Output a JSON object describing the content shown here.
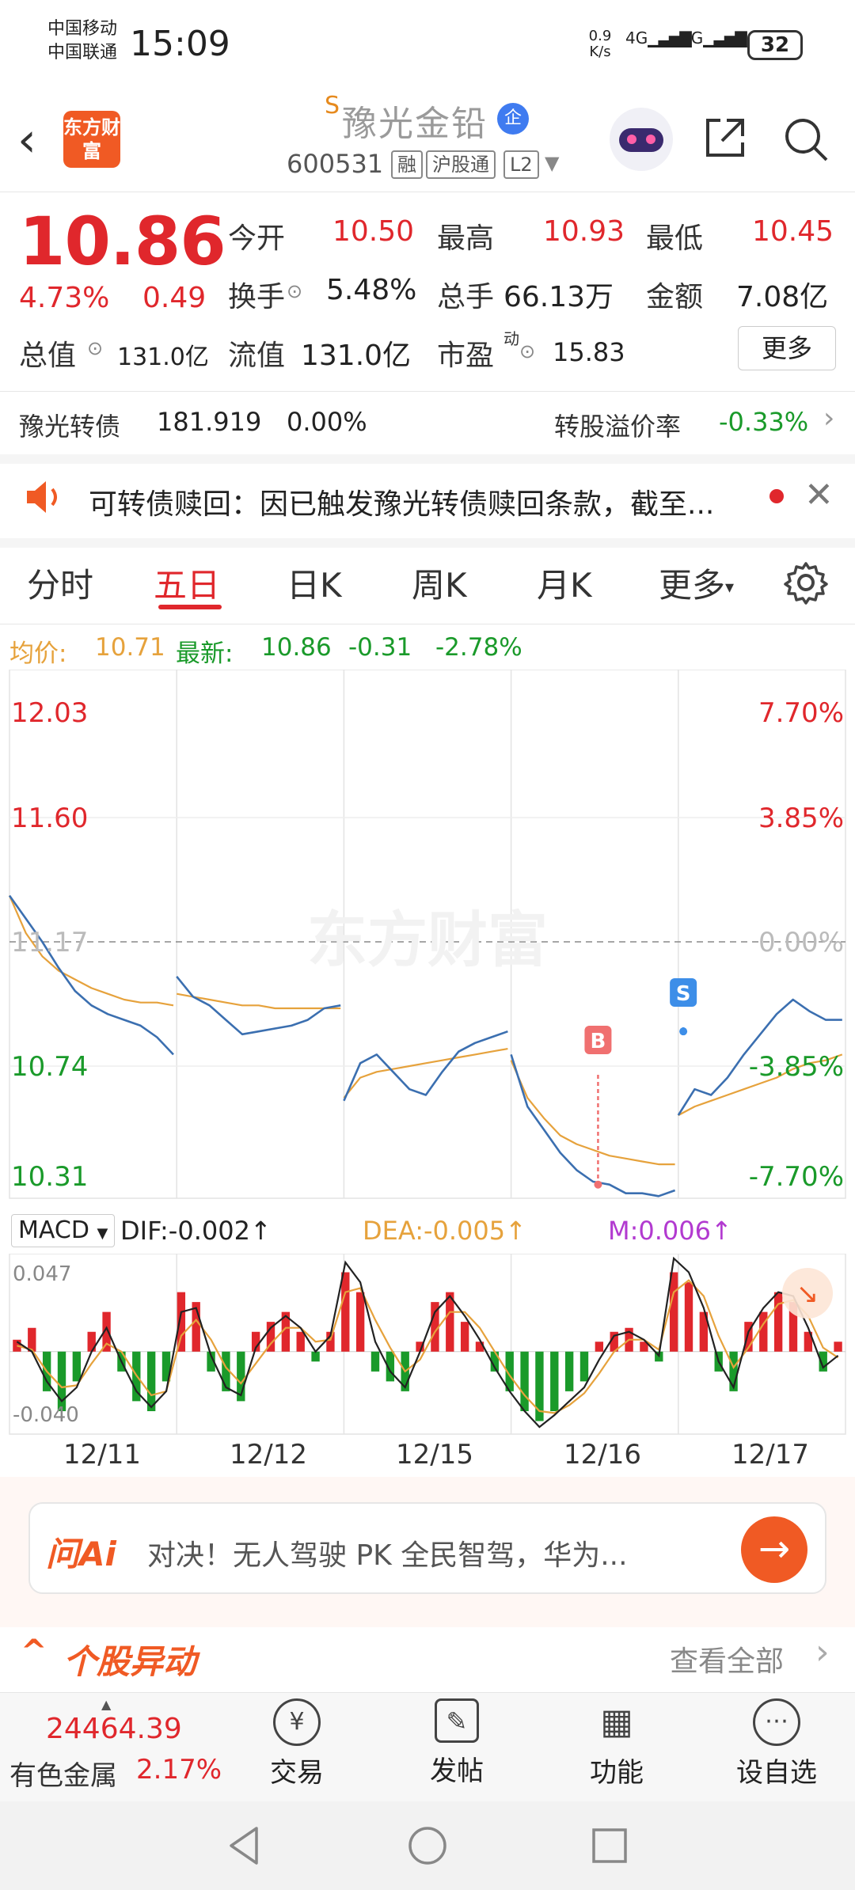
{
  "status": {
    "carrier1": "中国移动",
    "carrier2": "中国联通",
    "time": "15:09",
    "net_speed": "0.9",
    "net_unit": "K/s",
    "signal1": "4G",
    "signal2": "4G",
    "battery": "32"
  },
  "header": {
    "logo_text": "东方财富",
    "s_mark": "S",
    "stock_name": "豫光金铅",
    "badge": "企",
    "code": "600531",
    "tags": [
      "融",
      "沪股通",
      "L2"
    ]
  },
  "quote": {
    "price": "10.86",
    "change_pct": "4.73%",
    "change": "0.49",
    "open_label": "今开",
    "open": "10.50",
    "high_label": "最高",
    "high": "10.93",
    "low_label": "最低",
    "low": "10.45",
    "turnover_label": "换手",
    "turnover": "5.48%",
    "volume_label": "总手",
    "volume": "66.13万",
    "amount_label": "金额",
    "amount": "7.08亿",
    "mktcap_label": "总值",
    "mktcap": "131.0亿",
    "float_label": "流值",
    "float": "131.0亿",
    "pe_label": "市盈",
    "pe_sup": "动",
    "pe": "15.83",
    "more": "更多"
  },
  "bond": {
    "name": "豫光转债",
    "price": "181.919",
    "change": "0.00%",
    "premium_label": "转股溢价率",
    "premium": "-0.33%"
  },
  "notice": {
    "text": "可转债赎回：因已触发豫光转债赎回条款，截至..."
  },
  "tabs": [
    "分时",
    "五日",
    "日K",
    "周K",
    "月K",
    "更多"
  ],
  "active_tab": 1,
  "chart_info": {
    "avg_label": "均价:",
    "avg": "10.71",
    "latest_label": "最新:",
    "latest": "10.86",
    "chg": "-0.31",
    "chg_pct": "-2.78%"
  },
  "chart_data": {
    "type": "line",
    "x": [
      "12/11",
      "12/12",
      "12/15",
      "12/16",
      "12/17"
    ],
    "y_left_ticks": [
      "12.03",
      "11.60",
      "11.17",
      "10.74",
      "10.31"
    ],
    "y_right_ticks": [
      "7.70%",
      "3.85%",
      "0.00%",
      "-3.85%",
      "-7.70%"
    ],
    "ylim": [
      10.31,
      12.03
    ],
    "base": 11.17,
    "watermark": "东方财富",
    "markers": [
      {
        "label": "B",
        "day": "12/16",
        "price": 10.33
      },
      {
        "label": "S",
        "day": "12/17",
        "price": 10.86
      }
    ],
    "series": [
      {
        "name": "price",
        "color": "#3b6fb0",
        "values": [
          11.33,
          11.25,
          11.17,
          11.08,
          11.0,
          10.95,
          10.92,
          10.9,
          10.88,
          10.84,
          10.78,
          11.05,
          10.98,
          10.95,
          10.9,
          10.85,
          10.86,
          10.87,
          10.88,
          10.9,
          10.94,
          10.95,
          10.62,
          10.75,
          10.78,
          10.72,
          10.66,
          10.64,
          10.72,
          10.79,
          10.82,
          10.84,
          10.86,
          10.78,
          10.6,
          10.52,
          10.44,
          10.38,
          10.34,
          10.33,
          10.3,
          10.3,
          10.29,
          10.31,
          10.57,
          10.66,
          10.64,
          10.7,
          10.78,
          10.85,
          10.92,
          10.97,
          10.93,
          10.9,
          10.9
        ]
      },
      {
        "name": "avg",
        "color": "#e6a23c",
        "values": [
          11.33,
          11.2,
          11.12,
          11.07,
          11.04,
          11.01,
          10.99,
          10.97,
          10.96,
          10.96,
          10.95,
          10.99,
          10.98,
          10.97,
          10.96,
          10.95,
          10.95,
          10.94,
          10.94,
          10.94,
          10.94,
          10.94,
          10.63,
          10.7,
          10.72,
          10.73,
          10.74,
          10.75,
          10.76,
          10.77,
          10.78,
          10.79,
          10.8,
          10.76,
          10.63,
          10.56,
          10.5,
          10.47,
          10.45,
          10.43,
          10.42,
          10.41,
          10.4,
          10.4,
          10.57,
          10.6,
          10.62,
          10.64,
          10.66,
          10.68,
          10.7,
          10.73,
          10.75,
          10.76,
          10.78
        ]
      }
    ]
  },
  "macd": {
    "label": "MACD",
    "dif": "DIF:-0.002↑",
    "dea": "DEA:-0.005↑",
    "m": "M:0.006↑",
    "top": "0.047",
    "bottom": "-0.040",
    "colors": {
      "dif": "#222222",
      "dea": "#e6a23c",
      "m": "#b23ad0",
      "pos": "#e0272c",
      "neg": "#1a9a2a"
    },
    "hist": [
      0.006,
      0.012,
      -0.02,
      -0.03,
      -0.015,
      0.01,
      0.02,
      -0.01,
      -0.025,
      -0.03,
      -0.015,
      0.03,
      0.025,
      -0.01,
      -0.02,
      -0.025,
      0.01,
      0.015,
      0.02,
      0.01,
      -0.005,
      0.01,
      0.04,
      0.03,
      -0.01,
      -0.015,
      -0.02,
      0.005,
      0.025,
      0.03,
      0.015,
      0.005,
      -0.01,
      -0.02,
      -0.03,
      -0.035,
      -0.03,
      -0.02,
      -0.015,
      0.005,
      0.01,
      0.012,
      0.005,
      -0.005,
      0.04,
      0.035,
      0.02,
      -0.01,
      -0.02,
      0.015,
      0.02,
      0.03,
      0.025,
      0.01,
      -0.01,
      0.005
    ],
    "dif_line": [
      0.005,
      0.0,
      -0.015,
      -0.025,
      -0.018,
      0.0,
      0.012,
      -0.005,
      -0.02,
      -0.028,
      -0.02,
      0.02,
      0.022,
      -0.002,
      -0.018,
      -0.022,
      0.002,
      0.012,
      0.018,
      0.012,
      0.0,
      0.008,
      0.045,
      0.035,
      0.005,
      -0.01,
      -0.018,
      0.0,
      0.02,
      0.028,
      0.018,
      0.006,
      -0.008,
      -0.02,
      -0.03,
      -0.038,
      -0.032,
      -0.025,
      -0.018,
      -0.004,
      0.008,
      0.01,
      0.006,
      -0.002,
      0.047,
      0.04,
      0.022,
      -0.005,
      -0.018,
      0.01,
      0.022,
      0.03,
      0.028,
      0.012,
      -0.008,
      -0.002
    ],
    "dea_line": [
      0.003,
      0.001,
      -0.01,
      -0.018,
      -0.017,
      -0.006,
      0.004,
      0.0,
      -0.012,
      -0.022,
      -0.02,
      0.008,
      0.016,
      0.006,
      -0.008,
      -0.016,
      -0.006,
      0.004,
      0.012,
      0.012,
      0.005,
      0.006,
      0.03,
      0.032,
      0.016,
      0.002,
      -0.01,
      -0.004,
      0.01,
      0.02,
      0.02,
      0.012,
      0.0,
      -0.012,
      -0.022,
      -0.03,
      -0.031,
      -0.027,
      -0.021,
      -0.011,
      0.0,
      0.006,
      0.006,
      0.001,
      0.03,
      0.036,
      0.028,
      0.008,
      -0.008,
      0.002,
      0.014,
      0.024,
      0.026,
      0.018,
      0.002,
      -0.003
    ]
  },
  "ai": {
    "logo": "问Ai",
    "text": "对决！无人驾驶 PK 全民智驾，华为..."
  },
  "section": {
    "title": "个股异动",
    "link": "查看全部"
  },
  "bottom": {
    "index_value": "24464.39",
    "index_name": "有色金属",
    "index_pct": "2.17%",
    "items": [
      {
        "label": "交易",
        "icon": "¥"
      },
      {
        "label": "发帖",
        "icon": "✎"
      },
      {
        "label": "功能",
        "icon": "▦"
      },
      {
        "label": "设自选",
        "icon": "⋯"
      }
    ]
  }
}
